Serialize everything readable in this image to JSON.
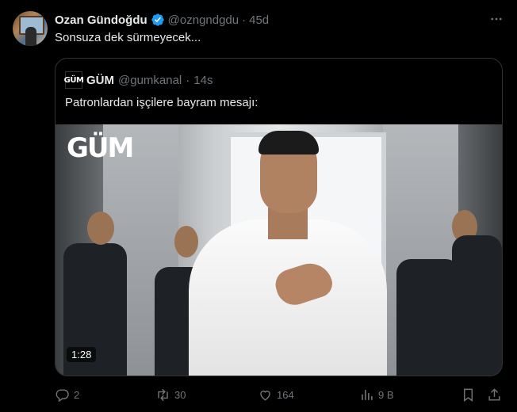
{
  "tweet": {
    "author_name": "Ozan Gündoğdu",
    "handle": "@ozngndgdu",
    "separator": "·",
    "time": "45d",
    "text": "Sonsuza dek sürmeyecek..."
  },
  "quote": {
    "logo_text": "GÜM",
    "author_name": "GÜM",
    "handle": "@gumkanal",
    "separator": "·",
    "time": "14s",
    "text": "Patronlardan işçilere bayram mesajı:",
    "media": {
      "watermark": "GÜM",
      "duration": "1:28"
    }
  },
  "actions": {
    "reply_count": "2",
    "retweet_count": "30",
    "like_count": "164",
    "views_count": "9 B"
  },
  "icons": {
    "verified": "verified-badge-icon",
    "more": "more-icon",
    "reply": "reply-icon",
    "retweet": "retweet-icon",
    "like": "heart-icon",
    "views": "views-icon",
    "bookmark": "bookmark-icon",
    "share": "share-icon"
  },
  "colors": {
    "background": "#000000",
    "text": "#e7e9ea",
    "muted": "#71767b",
    "verified": "#1d9bf0",
    "border": "#2f3336"
  }
}
